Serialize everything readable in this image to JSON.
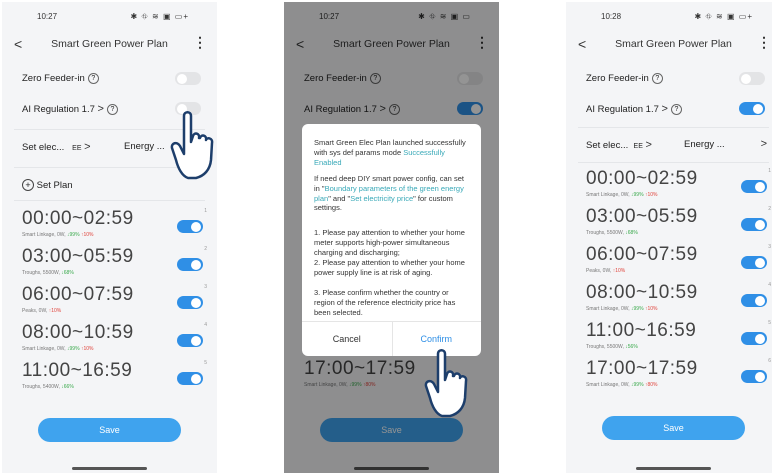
{
  "app": {
    "title": "Smart Green Power Plan"
  },
  "phones": [
    {
      "time": "10:27",
      "status_icons": "✱ ⛗ ≋ ▣ ▭+"
    },
    {
      "time": "10:27",
      "status_icons": "✱ ⛗ ≋ ▣ ▭"
    },
    {
      "time": "10:28",
      "status_icons": "✱ ⛗ ≋ ▣ ▭+"
    }
  ],
  "settings": {
    "zero_feeder_label": "Zero Feeder-in",
    "ai_regulation_label": "AI Regulation 1.7",
    "set_elec_label": "Set elec...",
    "set_elec_value": "EE",
    "energy_label": "Energy ...",
    "set_plan_label": "Set Plan",
    "icons": [
      "help-circle-icon",
      "chevron-right-icon",
      "add-circle-icon",
      "back-arrow-icon",
      "more-vertical-icon"
    ]
  },
  "toggles": {
    "phone1": {
      "zero_feeder": "off",
      "ai_regulation": "off",
      "plans": [
        "on",
        "on",
        "on",
        "on",
        "on"
      ]
    },
    "phone2": {
      "zero_feeder": "off",
      "ai_regulation": "on"
    },
    "phone3": {
      "zero_feeder": "off",
      "ai_regulation": "on",
      "plans": [
        "on",
        "on",
        "on",
        "on",
        "on",
        "on"
      ]
    }
  },
  "plans_phone1": [
    {
      "time": "00:00~02:59",
      "mode": "Smart Linkage, 0W,",
      "down": "99%",
      "up": "10%",
      "idx": "1"
    },
    {
      "time": "03:00~05:59",
      "mode": "Troughs, 5500W,",
      "down": "",
      "up": "",
      "low": "68%",
      "idx": "2"
    },
    {
      "time": "06:00~07:59",
      "mode": "Peaks, 0W,",
      "down": "",
      "up": "10%",
      "idx": "3"
    },
    {
      "time": "08:00~10:59",
      "mode": "Smart Linkage, 0W,",
      "down": "99%",
      "up": "10%",
      "idx": "4"
    },
    {
      "time": "11:00~16:59",
      "mode": "Troughs, 5400W,",
      "down": "",
      "up": "",
      "low": "66%",
      "idx": "5"
    }
  ],
  "plans_phone3": [
    {
      "time": "00:00~02:59",
      "mode": "Smart Linkage, 0W,",
      "down": "99%",
      "up": "10%",
      "idx": "1"
    },
    {
      "time": "03:00~05:59",
      "mode": "Troughs, 5500W,",
      "low": "68%",
      "idx": "2"
    },
    {
      "time": "06:00~07:59",
      "mode": "Peaks, 0W,",
      "up": "10%",
      "idx": "3"
    },
    {
      "time": "08:00~10:59",
      "mode": "Smart Linkage, 0W,",
      "down": "99%",
      "up": "10%",
      "idx": "4"
    },
    {
      "time": "11:00~16:59",
      "mode": "Troughs, 5500W,",
      "low": "56%",
      "idx": "5"
    },
    {
      "time": "17:00~17:59",
      "mode": "Smart Linkage, 0W,",
      "down": "99%",
      "up": "80%",
      "idx": "6"
    }
  ],
  "phone2_background_plan": {
    "time": "17:00~17:59",
    "mode": "Smart Linkage, 0W,",
    "down": "99%",
    "up": "80%"
  },
  "save_label": "Save",
  "dialog": {
    "p1_a": "Smart Green Elec Plan launched successfully with sys def params mode ",
    "p1_b": "Successfully Enabled",
    "p2_a": "If need deep DIY smart power config, can set in \"",
    "p2_b": "Boundary parameters of the green energy plan",
    "p2_c": "\" and \"",
    "p2_d": "Set electricity price",
    "p2_e": "\" for custom settings.",
    "p3": "1. Please pay attention to whether your home meter supports high-power simultaneous charging and discharging;",
    "p4": "2. Please pay attention to whether your home power supply line is at risk of aging.",
    "p5": "3. Please confirm whether the country or region of the reference electricity price has been selected.",
    "cancel": "Cancel",
    "confirm": "Confirm"
  },
  "colors": {
    "accent": "#2f8fe6",
    "save": "#3fa3ee",
    "highlight": "#39a9b8",
    "down": "#39a94b",
    "up": "#e0443c"
  }
}
